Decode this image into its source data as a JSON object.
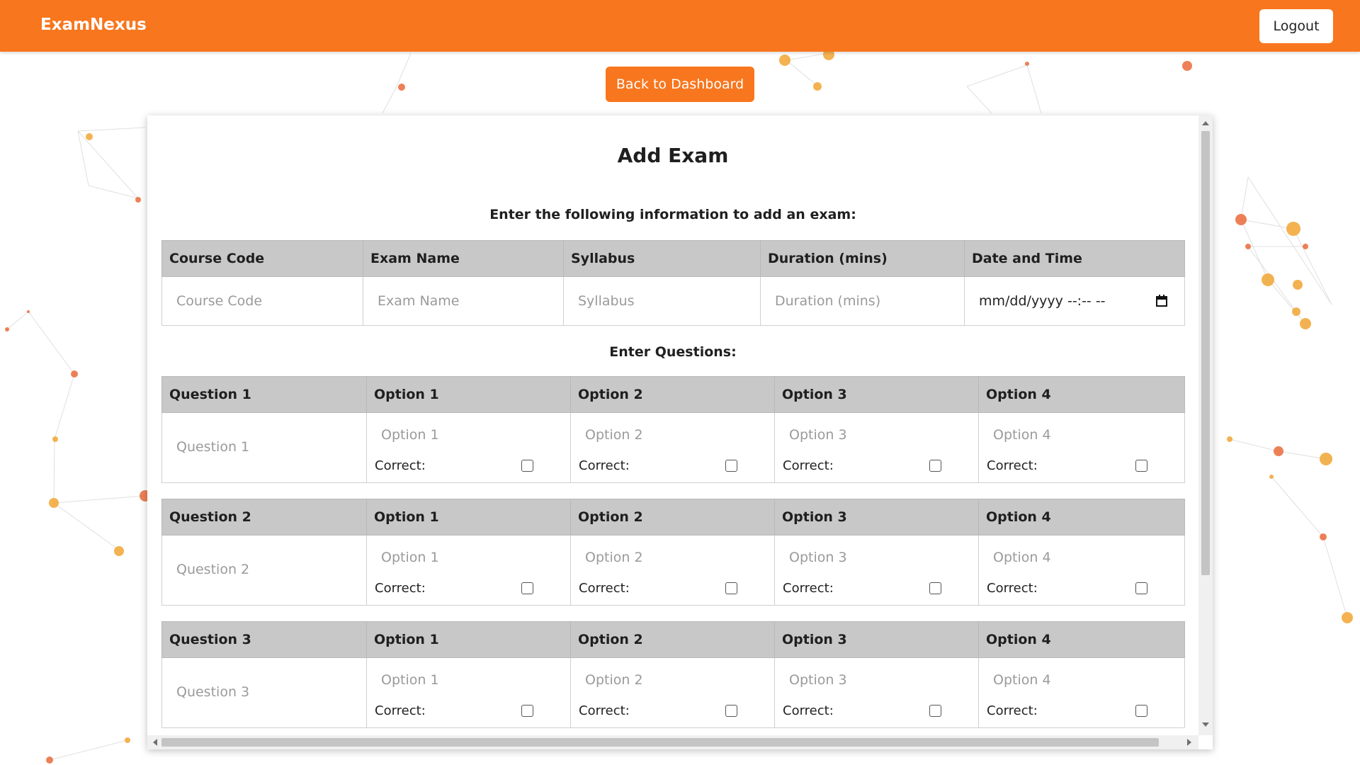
{
  "navbar": {
    "brand": "ExamNexus",
    "logout_label": "Logout"
  },
  "back_button": "Back to Dashboard",
  "card": {
    "title": "Add Exam",
    "subtitle": "Enter the following information to add an exam:",
    "info_headers": {
      "course_code": "Course Code",
      "exam_name": "Exam Name",
      "syllabus": "Syllabus",
      "duration": "Duration (mins)",
      "date_time": "Date and Time"
    },
    "info_placeholders": {
      "course_code": "Course Code",
      "exam_name": "Exam Name",
      "syllabus": "Syllabus",
      "duration": "Duration (mins)"
    },
    "date_value": "mm/dd/yyyy --:-- --",
    "questions_heading": "Enter Questions:",
    "questions": [
      {
        "header": "Question 1",
        "placeholder": "Question 1",
        "options": [
          {
            "header": "Option 1",
            "placeholder": "Option 1",
            "correct_label": "Correct:"
          },
          {
            "header": "Option 2",
            "placeholder": "Option 2",
            "correct_label": "Correct:"
          },
          {
            "header": "Option 3",
            "placeholder": "Option 3",
            "correct_label": "Correct:"
          },
          {
            "header": "Option 4",
            "placeholder": "Option 4",
            "correct_label": "Correct:"
          }
        ]
      },
      {
        "header": "Question 2",
        "placeholder": "Question 2",
        "options": [
          {
            "header": "Option 1",
            "placeholder": "Option 1",
            "correct_label": "Correct:"
          },
          {
            "header": "Option 2",
            "placeholder": "Option 2",
            "correct_label": "Correct:"
          },
          {
            "header": "Option 3",
            "placeholder": "Option 3",
            "correct_label": "Correct:"
          },
          {
            "header": "Option 4",
            "placeholder": "Option 4",
            "correct_label": "Correct:"
          }
        ]
      },
      {
        "header": "Question 3",
        "placeholder": "Question 3",
        "options": [
          {
            "header": "Option 1",
            "placeholder": "Option 1",
            "correct_label": "Correct:"
          },
          {
            "header": "Option 2",
            "placeholder": "Option 2",
            "correct_label": "Correct:"
          },
          {
            "header": "Option 3",
            "placeholder": "Option 3",
            "correct_label": "Correct:"
          },
          {
            "header": "Option 4",
            "placeholder": "Option 4",
            "correct_label": "Correct:"
          }
        ]
      }
    ]
  },
  "colors": {
    "accent": "#f8761d",
    "header_gray": "#c8c8c8"
  },
  "icons": {
    "date": "calendar-icon"
  }
}
